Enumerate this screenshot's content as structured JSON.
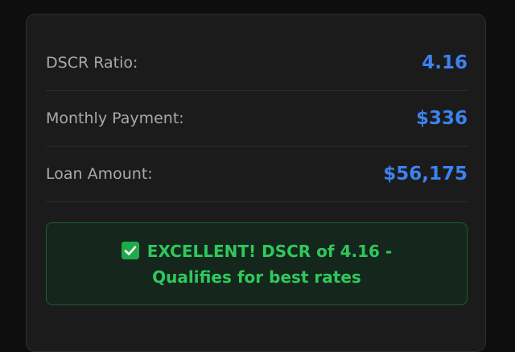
{
  "results": {
    "rows": [
      {
        "label": "DSCR Ratio:",
        "value": "4.16"
      },
      {
        "label": "Monthly Payment:",
        "value": "$336"
      },
      {
        "label": "Loan Amount:",
        "value": "$56,175"
      }
    ]
  },
  "status": {
    "icon": "check-mark-icon",
    "message": "EXCELLENT! DSCR of 4.16 - Qualifies for best rates",
    "color": "#2fc85c"
  },
  "colors": {
    "value_accent": "#3d82f0",
    "success": "#2fc85c"
  }
}
